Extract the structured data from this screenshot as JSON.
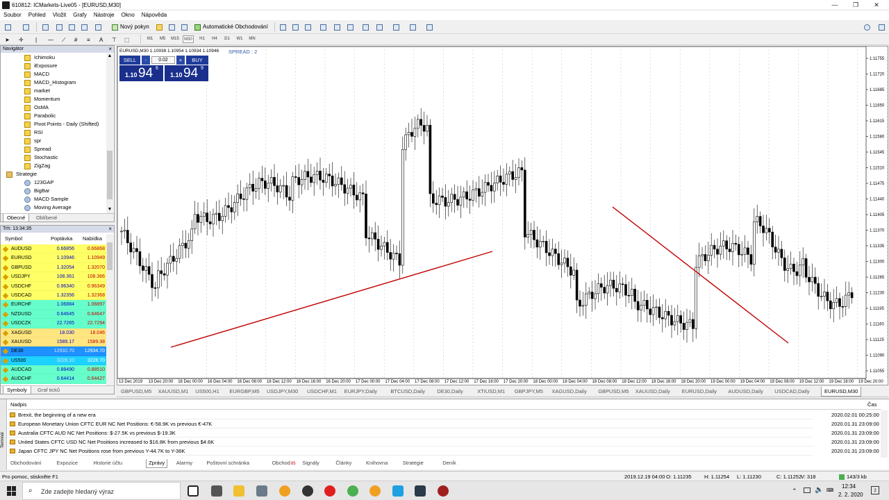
{
  "window": {
    "title": "610812: ICMarkets-Live05 - [EURUSD,M30]",
    "min": "—",
    "max": "❐",
    "close": "✕"
  },
  "menu": [
    "Soubor",
    "Pohled",
    "Vložit",
    "Grafy",
    "Nástroje",
    "Okno",
    "Nápověda"
  ],
  "toolbar": {
    "new_order": "Nový pokyn",
    "auto_trading": "Automatické Obchodování"
  },
  "timeframes": [
    "M1",
    "M5",
    "M15",
    "M30",
    "H1",
    "H4",
    "D1",
    "W1",
    "MN"
  ],
  "navigator": {
    "title": "Navigátor",
    "items": [
      {
        "label": "Ichimoku",
        "type": "ind"
      },
      {
        "label": "iExposure",
        "type": "ind"
      },
      {
        "label": "MACD",
        "type": "ind"
      },
      {
        "label": "MACD_Histogram",
        "type": "ind"
      },
      {
        "label": "market",
        "type": "ind"
      },
      {
        "label": "Momentum",
        "type": "ind"
      },
      {
        "label": "OsMA",
        "type": "ind"
      },
      {
        "label": "Parabolic",
        "type": "ind"
      },
      {
        "label": "Pivot Points - Daily (Shifted)",
        "type": "ind"
      },
      {
        "label": "RSI",
        "type": "ind"
      },
      {
        "label": "spr",
        "type": "ind"
      },
      {
        "label": "Spread",
        "type": "ind"
      },
      {
        "label": "Stochastic",
        "type": "ind"
      },
      {
        "label": "ZigZag",
        "type": "ind"
      },
      {
        "label": "Strategie",
        "type": "folder"
      },
      {
        "label": "123GAP",
        "type": "ea"
      },
      {
        "label": "BigBar",
        "type": "ea"
      },
      {
        "label": "MACD Sample",
        "type": "ea"
      },
      {
        "label": "Moving Average",
        "type": "ea"
      }
    ],
    "tabs": [
      "Obecné",
      "Oblíbené"
    ]
  },
  "market_watch": {
    "title": "Trh: 13:34:35",
    "columns": [
      "Symbol",
      "Poptávka",
      "Nabídka"
    ],
    "rows": [
      {
        "symbol": "AUDUSD",
        "bid": "0.66856",
        "ask": "0.66868",
        "bg": "#ffff66"
      },
      {
        "symbol": "EURUSD",
        "bid": "1.10946",
        "ask": "1.10949",
        "bg": "#ffff66"
      },
      {
        "symbol": "GBPUSD",
        "bid": "1.32054",
        "ask": "1.32070",
        "bg": "#ffff66"
      },
      {
        "symbol": "USDJPY",
        "bid": "108.361",
        "ask": "108.366",
        "bg": "#ffff66"
      },
      {
        "symbol": "USDCHF",
        "bid": "0.96340",
        "ask": "0.96349",
        "bg": "#ffff66"
      },
      {
        "symbol": "USDCAD",
        "bid": "1.32356",
        "ask": "1.32368",
        "bg": "#ffff66"
      },
      {
        "symbol": "EURCHF",
        "bid": "1.06884",
        "ask": "1.06897",
        "bg": "#66ffcc"
      },
      {
        "symbol": "NZDUSD",
        "bid": "0.64645",
        "ask": "0.64647",
        "bg": "#66ffcc"
      },
      {
        "symbol": "USDCZK",
        "bid": "22.7265",
        "ask": "22.7294",
        "bg": "#66ffcc"
      },
      {
        "symbol": "XAGUSD",
        "bid": "18.030",
        "ask": "18.046",
        "bg": "#ffe680"
      },
      {
        "symbol": "XAUUSD",
        "bid": "1589.17",
        "ask": "1589.38",
        "bg": "#ffe680"
      },
      {
        "symbol": "DE30",
        "bid": "12932.70",
        "ask": "12934.70",
        "bg": "#1e90ff"
      },
      {
        "symbol": "US500",
        "bid": "3228.10",
        "ask": "3228.70",
        "bg": "#1ed2ff"
      },
      {
        "symbol": "AUDCAD",
        "bid": "0.88490",
        "ask": "0.88510",
        "bg": "#66ffcc"
      },
      {
        "symbol": "AUDCHF",
        "bid": "0.64414",
        "ask": "0.64427",
        "bg": "#66ffcc"
      }
    ],
    "tabs": [
      "Symboly",
      "Graf ticků"
    ]
  },
  "chart": {
    "info": "EURUSD,M30  1.10938 1.10954 1.10934 1.10946",
    "spread": "SPREAD : 2",
    "sell_label": "SELL",
    "buy_label": "BUY",
    "lot": "0.02",
    "sell_prefix": "1.10",
    "sell_big": "94",
    "sell_sup": "6",
    "buy_prefix": "1.10",
    "buy_big": "94",
    "buy_sup": "9",
    "price_labels": [
      "1.11755",
      "1.11720",
      "1.11685",
      "1.11650",
      "1.11615",
      "1.11580",
      "1.11545",
      "1.11510",
      "1.11475",
      "1.11440",
      "1.11405",
      "1.11370",
      "1.11335",
      "1.11300",
      "1.11265",
      "1.11230",
      "1.11195",
      "1.11160",
      "1.11125",
      "1.11090",
      "1.11055"
    ],
    "time_labels": [
      "13 Dec 2019",
      "13 Dec 20:00",
      "16 Dec 00:00",
      "16 Dec 04:00",
      "16 Dec 08:00",
      "16 Dec 12:00",
      "16 Dec 16:00",
      "16 Dec 20:00",
      "17 Dec 00:00",
      "17 Dec 04:00",
      "17 Dec 08:00",
      "17 Dec 12:00",
      "17 Dec 16:00",
      "17 Dec 20:00",
      "18 Dec 00:00",
      "18 Dec 04:00",
      "18 Dec 08:00",
      "18 Dec 12:00",
      "18 Dec 16:00",
      "18 Dec 20:00",
      "19 Dec 00:00",
      "19 Dec 04:00",
      "19 Dec 08:00",
      "19 Dec 12:00",
      "19 Dec 16:00",
      "19 Dec 20:00"
    ],
    "line_color": "#c00000"
  },
  "chart_tabs": [
    "GBPUSD,M5",
    "XAUUSD,M1",
    "US500,H1",
    "EURGBP,M5",
    "USDJPY,M30",
    "USDCHF,M1",
    "EURJPY,Daily",
    "BTCUSD,Daily",
    "DE30,Daily",
    "XTIUSD,M1",
    "GBPJPY,M5",
    "XAGUSD,Daily",
    "GBPUSD,M5",
    "XAUUSD,Daily",
    "EURUSD,Daily",
    "AUDUSD,Daily",
    "USDCAD,Daily",
    "EURUSD,M30"
  ],
  "terminal": {
    "side_label": "Terminál",
    "header_title": "Nadpis",
    "header_time": "Čas",
    "news": [
      {
        "headline": "Brexit, the beginning of a new era",
        "time": "2020.02.01 00:25:00"
      },
      {
        "headline": "European Monetary Union CFTC EUR NC Net Positions: €-58.9K  vs previous €-47K",
        "time": "2020.01.31 23:09:00"
      },
      {
        "headline": "Australia CFTC AUD NC Net Positions: $-27.5K  vs previous $-19.3K",
        "time": "2020.01.31 23:09:00"
      },
      {
        "headline": "United States CFTC USD NC Net Positions increased to $16.8K from previous $4.6K",
        "time": "2020.01.31 23:09:00"
      },
      {
        "headline": "Japan CFTC JPY NC Net Positions rose from previous Y-44.7K to Y-36K",
        "time": "2020.01.31 23:09:00"
      }
    ],
    "tabs": [
      "Obchodování",
      "Expozice",
      "Historie účtu",
      "Zprávy",
      "Alarmy",
      "Poštovní schránka",
      "Obchod",
      "Signály",
      "Články",
      "Knihovna",
      "Strategie",
      "Deník"
    ],
    "market_badge": "85"
  },
  "status": {
    "help": "Pro pomoc, stiskněte F1",
    "date": "2019.12.19 04:00",
    "open": "O: 1.11235",
    "high": "H: 1.11254",
    "low": "L: 1.11230",
    "close": "C: 1.11252",
    "volume": "V: 318",
    "traffic": "143/3 kb"
  },
  "taskbar": {
    "search_placeholder": "Zde zadejte hledaný výraz",
    "time": "12:34",
    "date": "2. 2. 2020",
    "notif_count": "2"
  }
}
